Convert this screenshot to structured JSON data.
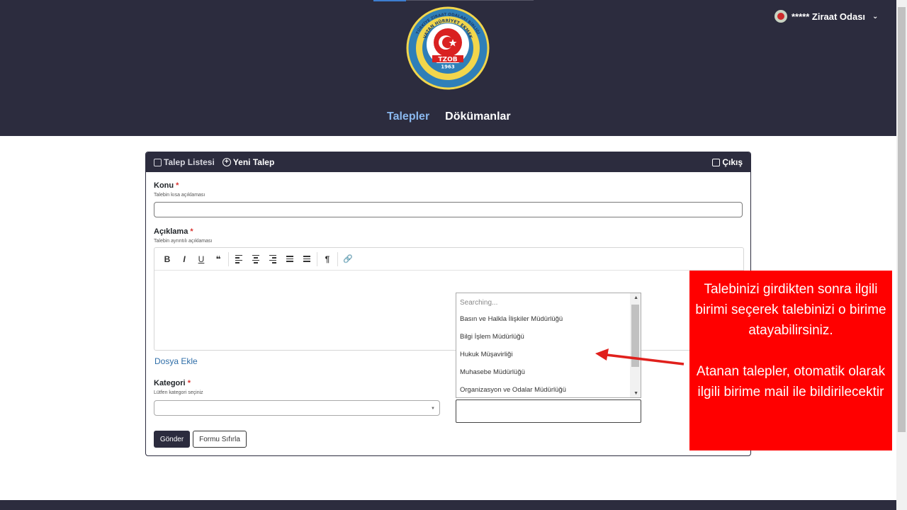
{
  "colors": {
    "header_bg": "#2c2c3e",
    "nav_active": "#8ab8ee",
    "required": "#d9322e",
    "link": "#2f6ea8",
    "callout_bg": "#ff0000",
    "arrow": "#e0201c"
  },
  "logo": {
    "ring_text": "TÜRKİYE ZİRAAT ODALARI BİRLİĞİ",
    "inner_text": "VATAN HÜRRİYET EKMEK",
    "code": "TZOB",
    "year": "1963"
  },
  "user_menu": {
    "name": "***** Ziraat Odası",
    "chevron": "⌄"
  },
  "nav": {
    "tab_requests": "Talepler",
    "tab_documents": "Dökümanlar"
  },
  "card_header": {
    "request_list": "Talep Listesi",
    "new_request": "Yeni Talep",
    "logout": "Çıkış"
  },
  "form": {
    "subject": {
      "label": "Konu",
      "required_mark": "*",
      "hint": "Talebin kısa açıklaması",
      "value": ""
    },
    "description": {
      "label": "Açıklama",
      "required_mark": "*",
      "hint": "Talebin ayrıntılı açıklaması"
    },
    "toolbar": {
      "bold": "B",
      "italic": "I",
      "underline": "U",
      "quote": "❝",
      "paragraph": "¶",
      "link": "🔗"
    },
    "attach_file": "Dosya Ekle",
    "category": {
      "label": "Kategori",
      "required_mark": "*",
      "hint": "Lütfen kategori seçiniz",
      "value": ""
    },
    "submit": "Gönder",
    "reset": "Formu Sıfırla"
  },
  "unit_dropdown": {
    "search_placeholder": "Searching...",
    "options": [
      "Basın ve Halkla İlişkiler Müdürlüğü",
      "Bilgi İşlem Müdürlüğü",
      "Hukuk Müşavirliği",
      "Muhasebe Müdürlüğü",
      "Organizasyon ve Odalar Müdürlüğü"
    ]
  },
  "callout": {
    "para1": "Talebinizi girdikten sonra ilgili birimi seçerek talebinizi o birime atayabilirsiniz.",
    "para2": "Atanan talepler, otomatik olarak ilgili birime mail ile bildirilecektir"
  }
}
